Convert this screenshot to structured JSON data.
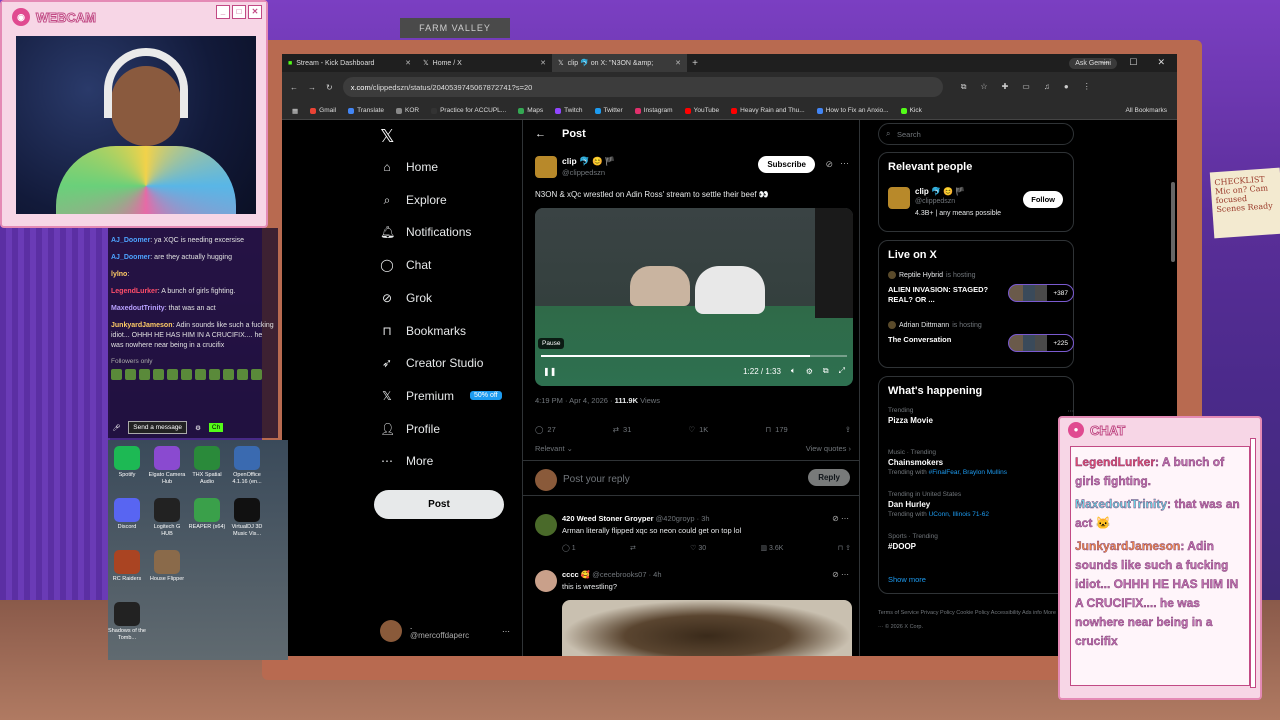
{
  "webcam": {
    "title": "WEBCAM",
    "buttons": [
      "_",
      "□",
      "✕"
    ]
  },
  "browser": {
    "tabs": [
      {
        "label": "Stream - Kick Dashboard"
      },
      {
        "label": "Home / X"
      },
      {
        "label": "clip 🐬 on X: \"N3ON &amp;"
      }
    ],
    "ask_gemini": "Ask Gemini",
    "url_host": "x.com",
    "url_path": "/clippedszn/status/2040539745067872741?s=20",
    "bookmarks": [
      {
        "label": "Gmail",
        "color": "#ea4335"
      },
      {
        "label": "Translate",
        "color": "#4285f4"
      },
      {
        "label": "KOR",
        "color": "#888888"
      },
      {
        "label": "Practice for ACCUPL...",
        "color": "#333333"
      },
      {
        "label": "Maps",
        "color": "#34a853"
      },
      {
        "label": "Twitch",
        "color": "#9146ff"
      },
      {
        "label": "Twitter",
        "color": "#1d9bf0"
      },
      {
        "label": "Instagram",
        "color": "#e1306c"
      },
      {
        "label": "YouTube",
        "color": "#ff0000"
      },
      {
        "label": "Heavy Rain and Thu...",
        "color": "#ff0000"
      },
      {
        "label": "How to Fix an Anxio...",
        "color": "#4285f4"
      },
      {
        "label": "Kick",
        "color": "#53fc18"
      }
    ],
    "all_bookmarks": "All Bookmarks"
  },
  "x": {
    "nav": [
      {
        "label": "Home",
        "icon": "⌂"
      },
      {
        "label": "Explore",
        "icon": "⌕"
      },
      {
        "label": "Notifications",
        "icon": "🔔︎"
      },
      {
        "label": "Chat",
        "icon": "◯"
      },
      {
        "label": "Grok",
        "icon": "⊘"
      },
      {
        "label": "Bookmarks",
        "icon": "⊓"
      },
      {
        "label": "Creator Studio",
        "icon": "➶"
      },
      {
        "label": "Premium",
        "icon": "𝕏"
      },
      {
        "label": "Profile",
        "icon": "👤︎"
      },
      {
        "label": "More",
        "icon": "⋯"
      }
    ],
    "premium_badge": "50% off",
    "post_button": "Post",
    "me": {
      "name": ".",
      "handle": "@mercoffdaperc"
    },
    "post": {
      "header": "Post",
      "author_name": "clip 🐬 😊 🏴",
      "author_handle": "@clippedszn",
      "subscribe": "Subscribe",
      "text": "N3ON & xQc wrestled on Adin Ross' stream to settle their beef 👀",
      "video_tooltip": "Pause",
      "video_time": "1:22 / 1:33",
      "video_progress": 0.88,
      "time_label": "4:19 PM · Apr 4, 2026 · ",
      "views": "111.9K",
      "views_suffix": " Views",
      "replies": "27",
      "reposts": "31",
      "likes": "1K",
      "bookmarks": "179",
      "relevant": "Relevant ⌄",
      "view_quotes": "View quotes ›",
      "reply_placeholder": "Post your reply",
      "reply_button": "Reply"
    },
    "replies": [
      {
        "name": "420 Weed Stoner Groyper",
        "handle": "@420groyp · 3h",
        "text": "Arman literally flipped xqc so neon could get on top lol",
        "replies": "1",
        "likes": "30",
        "views": "3.6K",
        "avatar": "#4a6a2a"
      },
      {
        "name": "cccc 🥰",
        "handle": "@cecebrooks07 · 4h",
        "text": "this is wrestling?",
        "avatar": "#c9a08a"
      }
    ],
    "search_placeholder": "Search",
    "relevant_people": {
      "title": "Relevant people",
      "name": "clip 🐬 😊 🏴",
      "handle": "@clippedszn",
      "bio": "4.3B+ | any means possible",
      "follow": "Follow"
    },
    "live": {
      "title": "Live on X",
      "items": [
        {
          "host": "Reptile Hybrid",
          "hosting": "is hosting",
          "title": "ALIEN INVASION: STAGED? REAL? OR ...",
          "count": "+387"
        },
        {
          "host": "Adrian Dittmann",
          "hosting": "is hosting",
          "title": "The Conversation",
          "count": "+225"
        }
      ]
    },
    "happening": {
      "title": "What's happening",
      "items": [
        {
          "context": "Trending",
          "topic": "Pizza Movie",
          "with": "",
          "tags": ""
        },
        {
          "context": "Music · Trending",
          "topic": "Chainsmokers",
          "with": "Trending with ",
          "tags": "#FinalFear, Braylon Mullins"
        },
        {
          "context": "Trending in United States",
          "topic": "Dan Hurley",
          "with": "Trending with ",
          "tags": "UConn, Illinois 71-62"
        },
        {
          "context": "Sports · Trending",
          "topic": "#DOOP",
          "with": "",
          "tags": ""
        }
      ],
      "show_more": "Show more"
    },
    "footer": "Terms of Service   Privacy Policy   Cookie Policy   Accessibility   Ads info   More ···   © 2026 X Corp."
  },
  "stream_chat": {
    "lines": [
      {
        "user": "AJ_Doomer",
        "text": ": ya XQC is needing excersise",
        "cls": "u1"
      },
      {
        "user": "AJ_Doomer",
        "text": ": are they actually hugging",
        "cls": "u1"
      },
      {
        "user": "lylno",
        "text": ":",
        "cls": "u4"
      },
      {
        "user": "LegendLurker",
        "text": ": A bunch of girls fighting.",
        "cls": "u2"
      },
      {
        "user": "MaxedoutTrinity",
        "text": ": that was an act",
        "cls": "u3"
      },
      {
        "user": "JunkyardJameson",
        "text": ": Adin sounds like such a fucking idiot... OHHH HE HAS HIM IN A CRUCIFIX.... he was nowhere near being in a crucifix",
        "cls": "u4"
      }
    ],
    "followers_only": "Followers only",
    "send": "Send a message",
    "chat_btn": "Ch"
  },
  "desktop_icons": [
    {
      "label": "Spotify",
      "color": "#1db954"
    },
    {
      "label": "Elgato Camera Hub",
      "color": "#8a4ad0"
    },
    {
      "label": "THX Spatial Audio",
      "color": "#2a8a3a"
    },
    {
      "label": "OpenOffice 4.1.16 (en...",
      "color": "#3a6ab0"
    },
    {
      "label": "Discord",
      "color": "#5865f2"
    },
    {
      "label": "Logitech G HUB",
      "color": "#222222"
    },
    {
      "label": "REAPER (x64)",
      "color": "#3aa04a"
    },
    {
      "label": "VirtualDJ 3D Music Vis...",
      "color": "#111111"
    },
    {
      "label": "RC Raiders",
      "color": "#aa4422"
    },
    {
      "label": "House Flipper",
      "color": "#8a6a4a"
    },
    {
      "label": "Shadows of the Tomb...",
      "color": "#222222"
    }
  ],
  "chat_panel": {
    "title": "CHAT",
    "messages": [
      {
        "user": "LegendLurker",
        "text": ": A bunch of girls fighting.",
        "cls": "nm3"
      },
      {
        "user": "MaxedoutTrinity",
        "text": ": that was an act 🐱",
        "cls": "nm"
      },
      {
        "user": "JunkyardJameson",
        "text": ": Adin sounds like such a fucking idiot... OHHH HE HAS HIM IN A CRUCIFIX.... he was nowhere near being in a crucifix",
        "cls": "nm2"
      }
    ]
  },
  "scene": {
    "sign": "FARM VALLEY",
    "note": "CHECKLIST Mic on? Cam focused Scenes Ready"
  }
}
